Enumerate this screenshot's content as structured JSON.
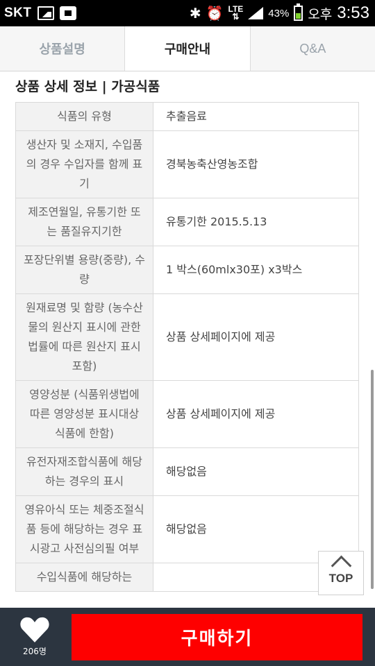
{
  "status": {
    "carrier": "SKT",
    "lte": "LTE",
    "battery": "43%",
    "battery_level": 0.43,
    "ampm": "오후",
    "time": "3:53",
    "icons": [
      "image-icon",
      "app-badge-icon",
      "bluetooth-icon",
      "alarm-icon",
      "lte-icon",
      "signal-icon",
      "battery-icon"
    ]
  },
  "tabs": [
    {
      "label": "상품설명",
      "active": false
    },
    {
      "label": "구매안내",
      "active": true
    },
    {
      "label": "Q&A",
      "active": false
    }
  ],
  "section_title": "상품 상세 정보 | 가공식품",
  "spec_rows": [
    {
      "key": "식품의 유형",
      "value": "추출음료"
    },
    {
      "key": "생산자 및 소재지, 수입품의 경우 수입자를 함께 표기",
      "value": "경북농축산영농조합"
    },
    {
      "key": "제조연월일, 유통기한 또는 품질유지기한",
      "value": "유통기한 2015.5.13"
    },
    {
      "key": "포장단위별 용량(중량), 수량",
      "value": "1 박스(60mlx30포) x3박스"
    },
    {
      "key": "원재료명 및 함량 (농수산물의 원산지 표시에 관한 법률에 따른 원산지 표시 포함)",
      "value": "상품 상세페이지에 제공"
    },
    {
      "key": "영양성분 (식품위생법에 따른 영양성분 표시대상 식품에 한함)",
      "value": "상품 상세페이지에 제공"
    },
    {
      "key": "유전자재조합식품에 해당하는 경우의 표시",
      "value": "해당없음"
    },
    {
      "key": "영유아식 또는 체중조절식품 등에 해당하는 경우 표시광고 사전심의필 여부",
      "value": "해당없음"
    },
    {
      "key": "수입식품에 해당하는",
      "value": ""
    }
  ],
  "top_button": "TOP",
  "like_count": "206명",
  "buy_label": "구매하기",
  "colors": {
    "buy": "#fe0000",
    "bottom_bar": "#2c3540",
    "table_key_bg": "#f2f2f2"
  }
}
